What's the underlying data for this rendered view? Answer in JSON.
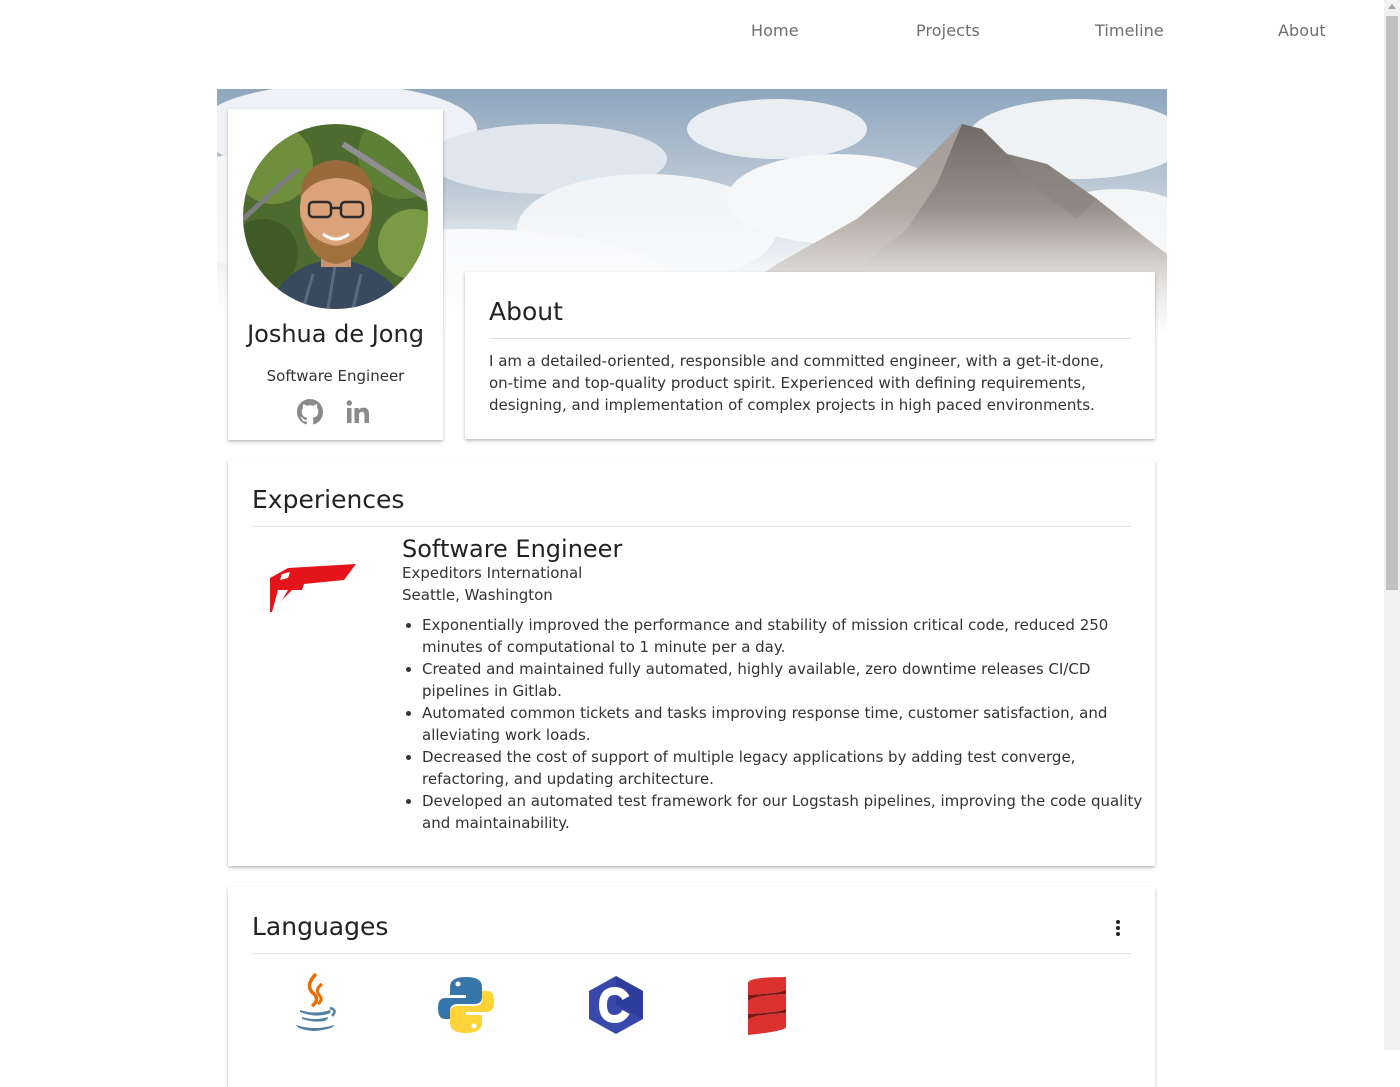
{
  "nav": {
    "items": [
      {
        "label": "Home"
      },
      {
        "label": "Projects"
      },
      {
        "label": "Timeline"
      },
      {
        "label": "About"
      }
    ]
  },
  "profile": {
    "name": "Joshua de Jong",
    "role": "Software Engineer",
    "social_icons": [
      "github-icon",
      "linkedin-icon"
    ]
  },
  "about": {
    "title": "About",
    "text": "I am a detailed-oriented, responsible and committed engineer, with a get-it-done, on-time and top-quality product spirit. Experienced with defining requirements, designing, and implementation of complex projects in high paced environments."
  },
  "experiences": {
    "title": "Experiences",
    "items": [
      {
        "title": "Software Engineer",
        "company": "Expeditors International",
        "location": "Seattle, Washington",
        "bullets": [
          "Exponentially improved the performance and stability of mission critical code, reduced 250 minutes of computational to 1 minute per a day.",
          "Created and maintained fully automated, highly available, zero downtime releases CI/CD pipelines in Gitlab.",
          "Automated common tickets and tasks improving response time, customer satisfaction, and alleviating work loads.",
          "Decreased the cost of support of multiple legacy applications by adding test converge, refactoring, and updating architecture.",
          "Developed an automated test framework for our Logstash pipelines, improving the code quality and maintainability."
        ]
      }
    ]
  },
  "languages": {
    "title": "Languages",
    "icons": [
      "java-icon",
      "python-icon",
      "c-language-icon",
      "scala-icon"
    ]
  },
  "colors": {
    "nav_text": "#6e6e6e",
    "expeditors_red": "#e3151b",
    "python_blue": "#3776ab",
    "python_yellow": "#ffd43b",
    "c_purple": "#3949ab",
    "scala_red": "#dc322f",
    "java_red": "#e76f00",
    "java_blue": "#5382a1"
  }
}
